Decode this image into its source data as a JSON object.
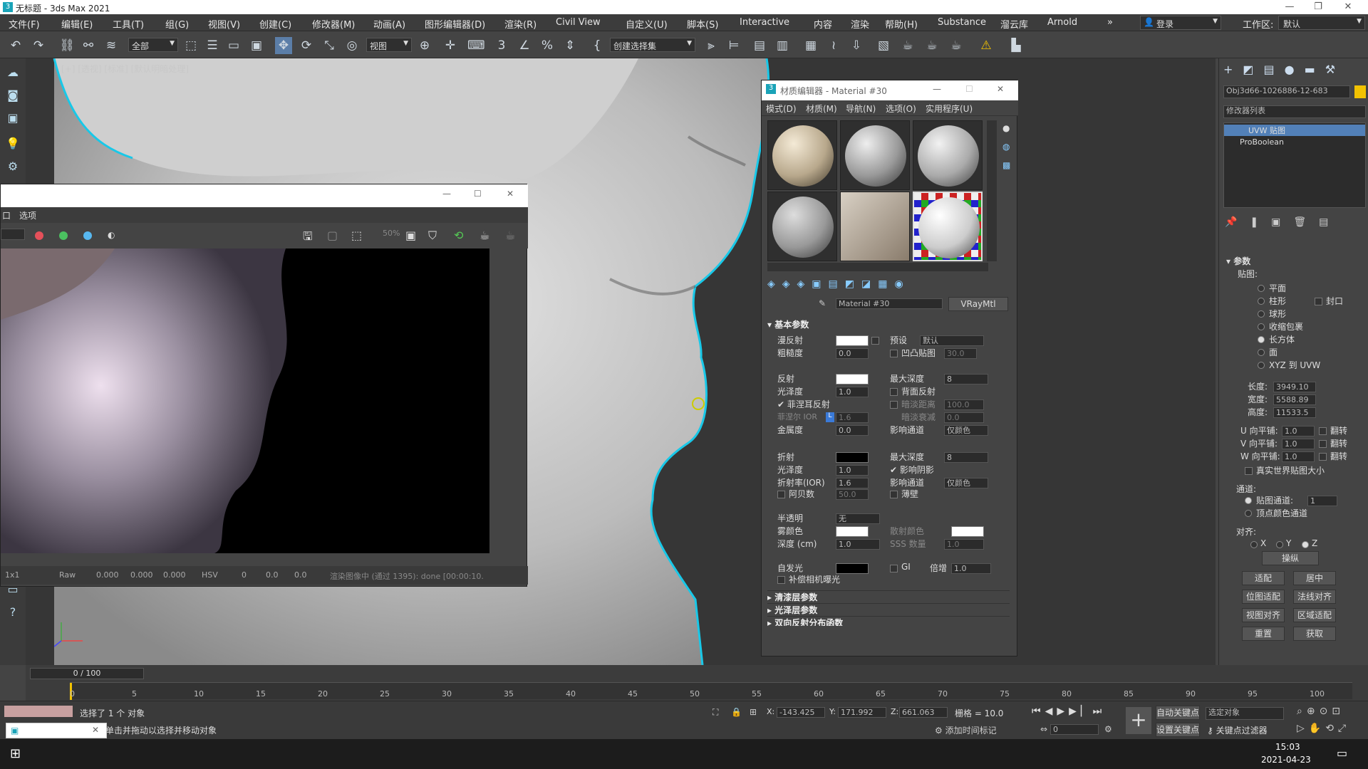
{
  "app": {
    "title": "无标题 - 3ds Max 2021",
    "logo": "3"
  },
  "menu": [
    "文件(F)",
    "编辑(E)",
    "工具(T)",
    "组(G)",
    "视图(V)",
    "创建(C)",
    "修改器(M)",
    "动画(A)",
    "图形编辑器(D)",
    "渲染(R)",
    "Civil View",
    "自定义(U)",
    "脚本(S)",
    "Interactive",
    "内容",
    "渲染",
    "帮助(H)",
    "Substance",
    "溜云库",
    "Arnold",
    "»"
  ],
  "account": {
    "login": "登录",
    "workspace_label": "工作区:",
    "workspace_value": "默认"
  },
  "toolbar": {
    "filter": "全部",
    "view": "视图",
    "selection_set": "创建选择集"
  },
  "viewport": {
    "label": "[+] [透视] [标准] [默认明暗处理]"
  },
  "render_window": {
    "menu": [
      "口",
      "选项"
    ],
    "status_zoom": "1x1",
    "status_raw": "Raw",
    "vals": [
      "0.000",
      "0.000",
      "0.000"
    ],
    "mode": "HSV",
    "vals2": [
      "0",
      "0.0",
      "0.0"
    ],
    "message": "渲染图像中 (通过 1395): done [00:00:10."
  },
  "mat_editor": {
    "title": "材质编辑器 - Material #30",
    "menu": [
      "模式(D)",
      "材质(M)",
      "导航(N)",
      "选项(O)",
      "实用程序(U)"
    ],
    "mat_name": "Material #30",
    "mat_type": "VRayMtl",
    "sections": {
      "basic": "基本参数",
      "coat": "清漆层参数",
      "sheen": "光泽层参数",
      "brdf": "双向反射分布函数"
    },
    "rows": {
      "diffuse": "漫反射",
      "preset": "预设",
      "preset_val": "默认",
      "roughness": "粗糙度",
      "roughness_val": "0.0",
      "bump": "凹凸贴图",
      "bump_val": "30.0",
      "reflect": "反射",
      "maxdepth": "最大深度",
      "maxdepth_val": "8",
      "gloss": "光泽度",
      "gloss_val": "1.0",
      "backside": "背面反射",
      "fresnel": "菲涅耳反射",
      "dim_dist": "暗淡距离",
      "dim_dist_val": "100.0",
      "fresnel_ior": "菲涅尔 IOR",
      "fresnel_ior_lock": "L",
      "fresnel_ior_val": "1.6",
      "dim_falloff": "暗淡衰减",
      "dim_falloff_val": "0.0",
      "metal": "金属度",
      "metal_val": "0.0",
      "affect": "影响通道",
      "affect_val": "仅颜色",
      "refract": "折射",
      "maxdepth2_val": "8",
      "gloss2_val": "1.0",
      "affect_shadow": "影响阴影",
      "ior": "折射率(IOR)",
      "ior_val": "1.6",
      "affect2_val": "仅颜色",
      "abbe": "阿贝数",
      "abbe_val": "50.0",
      "thin": "薄壁",
      "translucent": "半透明",
      "translucent_val": "无",
      "fog": "雾颜色",
      "scatter": "散射颜色",
      "depth": "深度 (cm)",
      "depth_val": "1.0",
      "sss": "SSS 数量",
      "sss_val": "1.0",
      "self_illum": "自发光",
      "gi": "GI",
      "mult": "倍增",
      "mult_val": "1.0",
      "comp_cam": "补偿相机曝光"
    }
  },
  "right": {
    "object_name": "Obj3d66-1026886-12-683",
    "modlist": "修改器列表",
    "stack": [
      "UVW 贴图",
      "ProBoolean"
    ],
    "params": "参数",
    "mapping": "贴图:",
    "mapping_opts": [
      "平面",
      "柱形",
      "球形",
      "收缩包裹",
      "长方体",
      "面",
      "XYZ 到 UVW"
    ],
    "cap": "封口",
    "length": "长度:",
    "length_val": "3949.10",
    "width": "宽度:",
    "width_val": "5588.89",
    "height": "高度:",
    "height_val": "11533.5",
    "u_tile": "U 向平铺:",
    "v_tile": "V 向平铺:",
    "w_tile": "W 向平铺:",
    "tile_val": "1.0",
    "flip": "翻转",
    "realworld": "真实世界贴图大小",
    "channel": "通道:",
    "map_channel": "贴图通道:",
    "map_channel_val": "1",
    "vertex_color": "顶点颜色通道",
    "align": "对齐:",
    "axes": [
      "X",
      "Y",
      "Z"
    ],
    "manip": "操纵",
    "btns": [
      "适配",
      "居中",
      "位图适配",
      "法线对齐",
      "视图对齐",
      "区域适配",
      "重置",
      "获取"
    ]
  },
  "timeline": {
    "frame": "0 / 100",
    "ticks": [
      "0",
      "5",
      "10",
      "15",
      "20",
      "25",
      "30",
      "35",
      "40",
      "45",
      "50",
      "55",
      "60",
      "65",
      "70",
      "75",
      "80",
      "85",
      "90",
      "95",
      "100"
    ]
  },
  "status": {
    "selected": "选择了 1 个 对象",
    "hint": "单击并拖动以选择并移动对象",
    "x": "-143.425",
    "y": "171.992",
    "z": "661.063",
    "grid": "栅格 = 10.0",
    "add_time_tag": "添加时间标记",
    "autokey": "自动关键点",
    "setkey": "设置关键点",
    "selected_obj": "选定对象",
    "key_filter": "关键点过滤器",
    "frame_val": "0"
  },
  "taskbar": {
    "time": "15:03",
    "date": "2021-04-23"
  }
}
